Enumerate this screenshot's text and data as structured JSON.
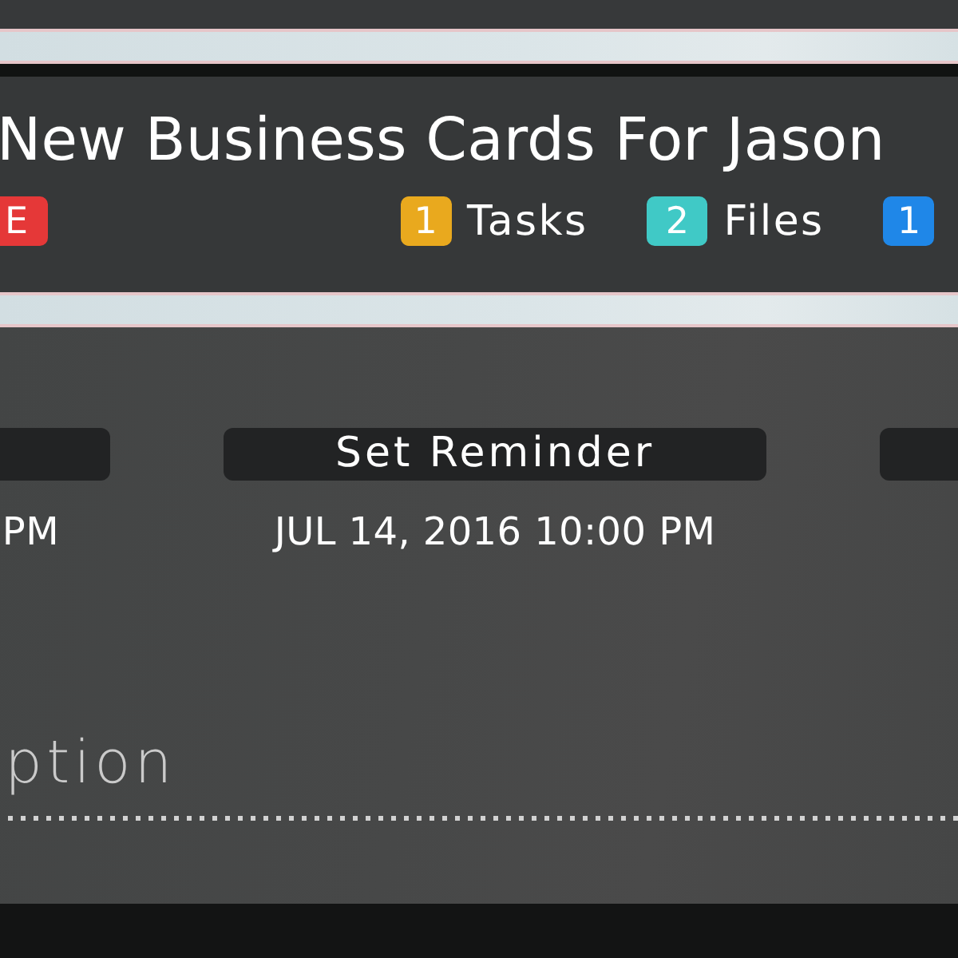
{
  "header": {
    "title": "New Business Cards For Jason",
    "status_badge": "E",
    "counts": [
      {
        "count": "1",
        "label": "Tasks",
        "color": "#e9a91e"
      },
      {
        "count": "2",
        "label": "Files",
        "color": "#40c9c6"
      },
      {
        "count": "1",
        "color": "#1f87e8"
      }
    ]
  },
  "schedule": [
    {
      "date": "PM"
    },
    {
      "button": "Set Reminder",
      "date": "JUL 14, 2016 10:00 PM"
    }
  ],
  "description": {
    "placeholder": "ption"
  }
}
